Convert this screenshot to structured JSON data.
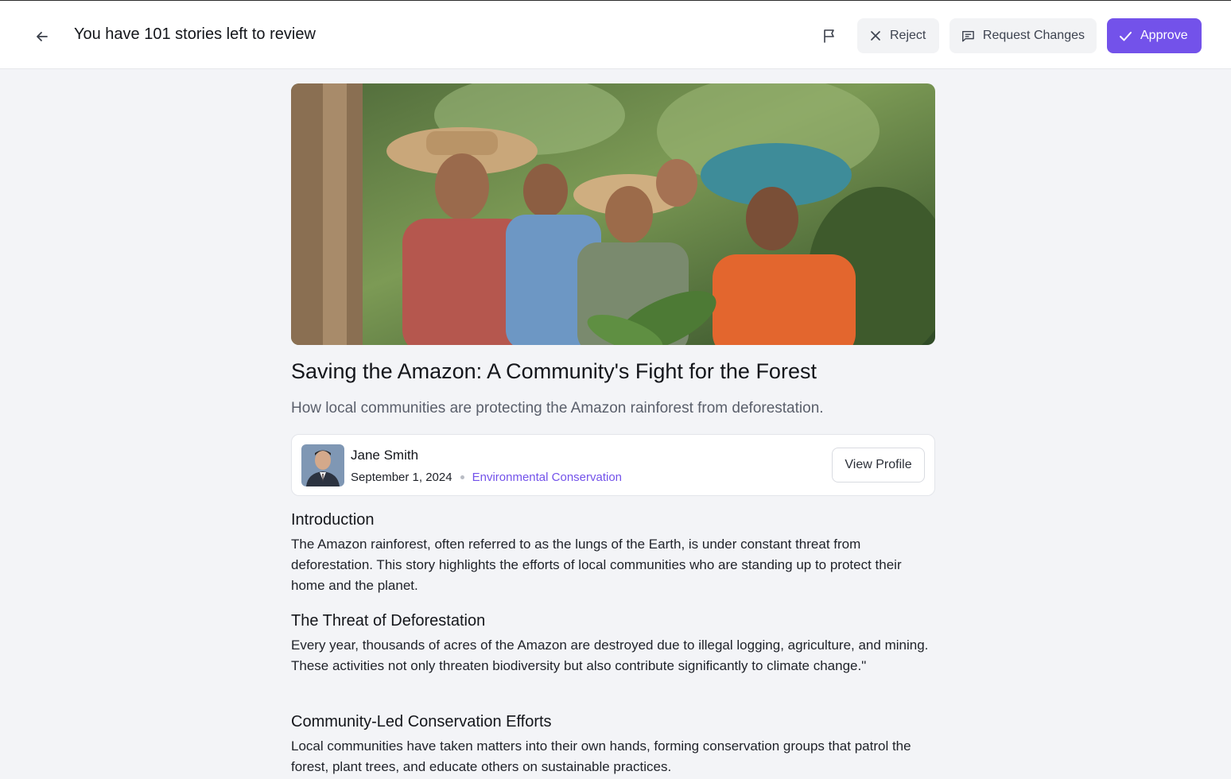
{
  "header": {
    "title": "You have 101 stories left to review",
    "reject_label": "Reject",
    "request_changes_label": "Request Changes",
    "approve_label": "Approve"
  },
  "story": {
    "title": "Saving the Amazon: A Community's Fight for the Forest",
    "subtitle": "How local communities are protecting the Amazon rainforest from deforestation.",
    "author": {
      "name": "Jane Smith",
      "date": "September 1, 2024",
      "category": "Environmental Conservation",
      "view_profile_label": "View Profile"
    },
    "sections": [
      {
        "heading": "Introduction",
        "body": "The Amazon rainforest, often referred to as the lungs of the Earth, is under constant threat from deforestation. This story highlights the efforts of local communities who are standing up to protect their home and the planet."
      },
      {
        "heading": "The Threat of Deforestation",
        "body": "Every year, thousands of acres of the Amazon are destroyed due to illegal logging, agriculture, and mining. These activities not only threaten biodiversity but also contribute significantly to climate change.\""
      },
      {
        "heading": "Community-Led Conservation Efforts",
        "body": "Local communities have taken matters into their own hands, forming conservation groups that patrol the forest, plant trees, and educate others on sustainable practices."
      }
    ]
  },
  "colors": {
    "accent": "#7352ea",
    "background": "#f3f4f7"
  },
  "icons": [
    "arrow-left-icon",
    "flag-icon",
    "x-icon",
    "message-square-icon",
    "check-icon"
  ]
}
